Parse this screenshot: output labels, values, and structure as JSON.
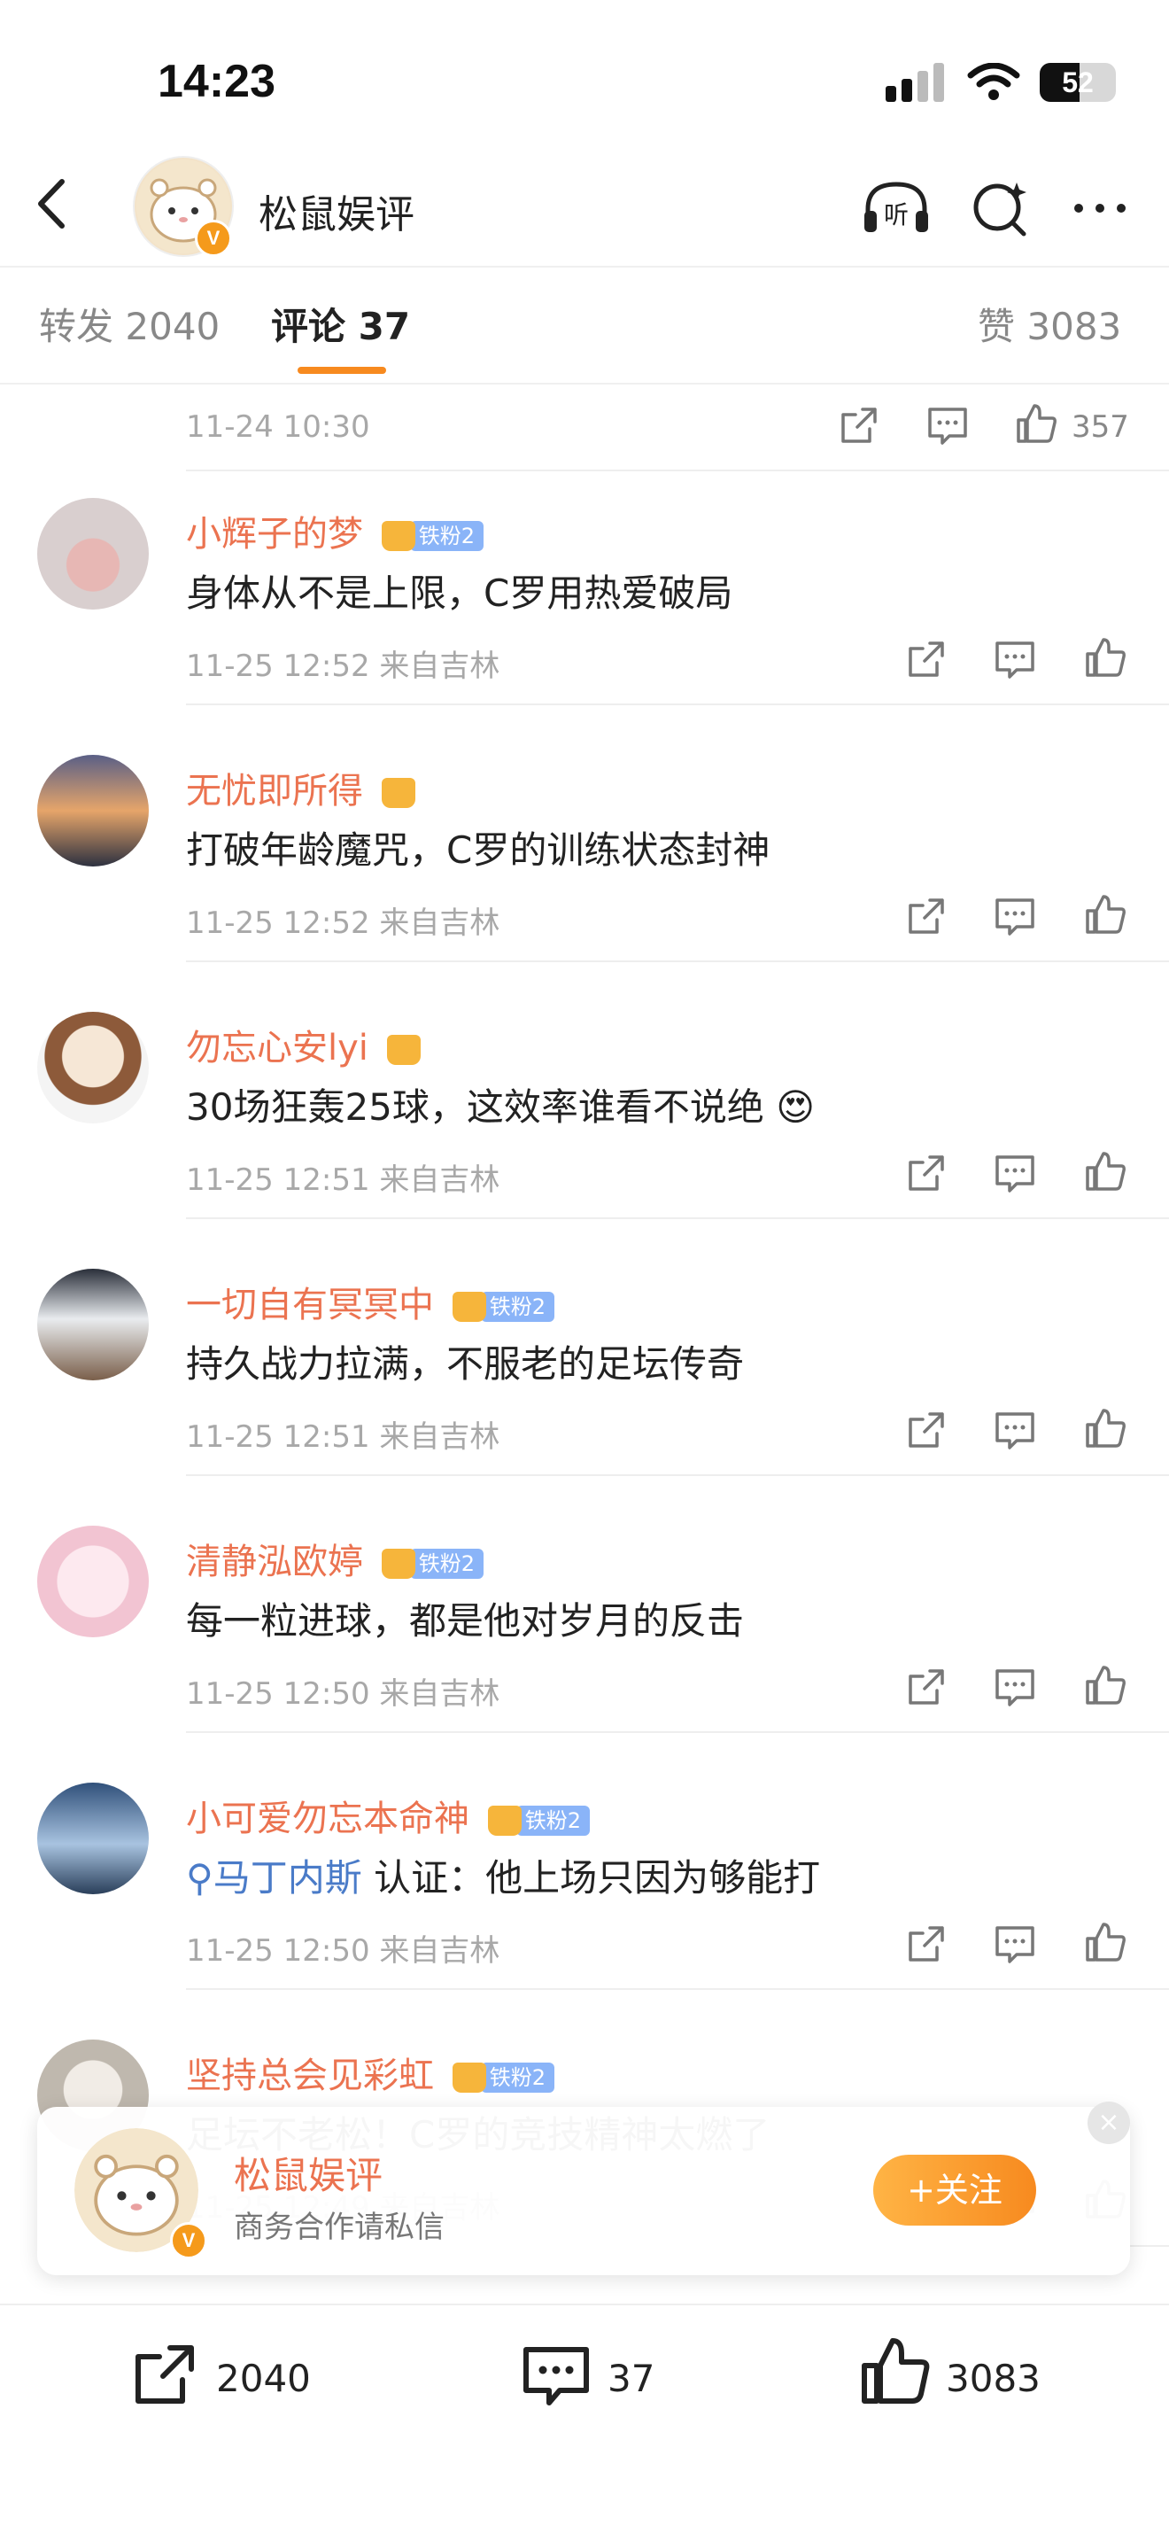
{
  "status": {
    "time": "14:23",
    "battery": "52",
    "battery_level": 0.52
  },
  "header": {
    "title": "松鼠娱评",
    "verified_badge": "V",
    "icons": [
      "back-icon",
      "listen-icon",
      "search-icon",
      "more-icon"
    ],
    "listen_label": "听"
  },
  "tabs": [
    {
      "label": "转发",
      "count": "2040"
    },
    {
      "label": "评论",
      "count": "37"
    },
    {
      "label": "赞",
      "count": "3083"
    }
  ],
  "first_row": {
    "time": "11-24 10:30",
    "likes": "357"
  },
  "comments": [
    {
      "user": "小辉子的梦",
      "badge": "铁粉2",
      "text": "身体从不是上限，C罗用热爱破局",
      "time": "11-25 12:52",
      "location": "来自吉林"
    },
    {
      "user": "无忧即所得",
      "badge": "",
      "text": "打破年龄魔咒，C罗的训练状态封神",
      "time": "11-25 12:52",
      "location": "来自吉林"
    },
    {
      "user": "勿忘心安lyi",
      "badge": "",
      "text": "30场狂轰25球，这效率谁看不说绝",
      "emoji": "😍",
      "time": "11-25 12:51",
      "location": "来自吉林"
    },
    {
      "user": "一切自有冥冥中",
      "badge": "铁粉2",
      "text": "持久战力拉满，不服老的足坛传奇",
      "time": "11-25 12:51",
      "location": "来自吉林"
    },
    {
      "user": "清静泓欧婷",
      "badge": "铁粉2",
      "text": "每一粒进球，都是他对岁月的反击",
      "time": "11-25 12:50",
      "location": "来自吉林"
    },
    {
      "user": "小可爱勿忘本命神",
      "badge": "铁粉2",
      "link": "马丁内斯",
      "text": "认证：他上场只因为够能打",
      "time": "11-25 12:50",
      "location": "来自吉林"
    },
    {
      "user": "坚持总会见彩虹",
      "badge": "铁粉2",
      "text": "足坛不老松！C罗的竞技精神太燃了",
      "time": "11-25 12:49",
      "location": "来自吉林"
    }
  ],
  "follow_card": {
    "title": "松鼠娱评",
    "subtitle": "商务合作请私信",
    "button": "+关注",
    "close": "×",
    "verified_badge": "V"
  },
  "bottom_bar": {
    "reposts": "2040",
    "comments": "37",
    "likes": "3083"
  },
  "colors": {
    "accent": "#f78a1f",
    "username": "#eb7350",
    "link": "#4a7bc8"
  }
}
